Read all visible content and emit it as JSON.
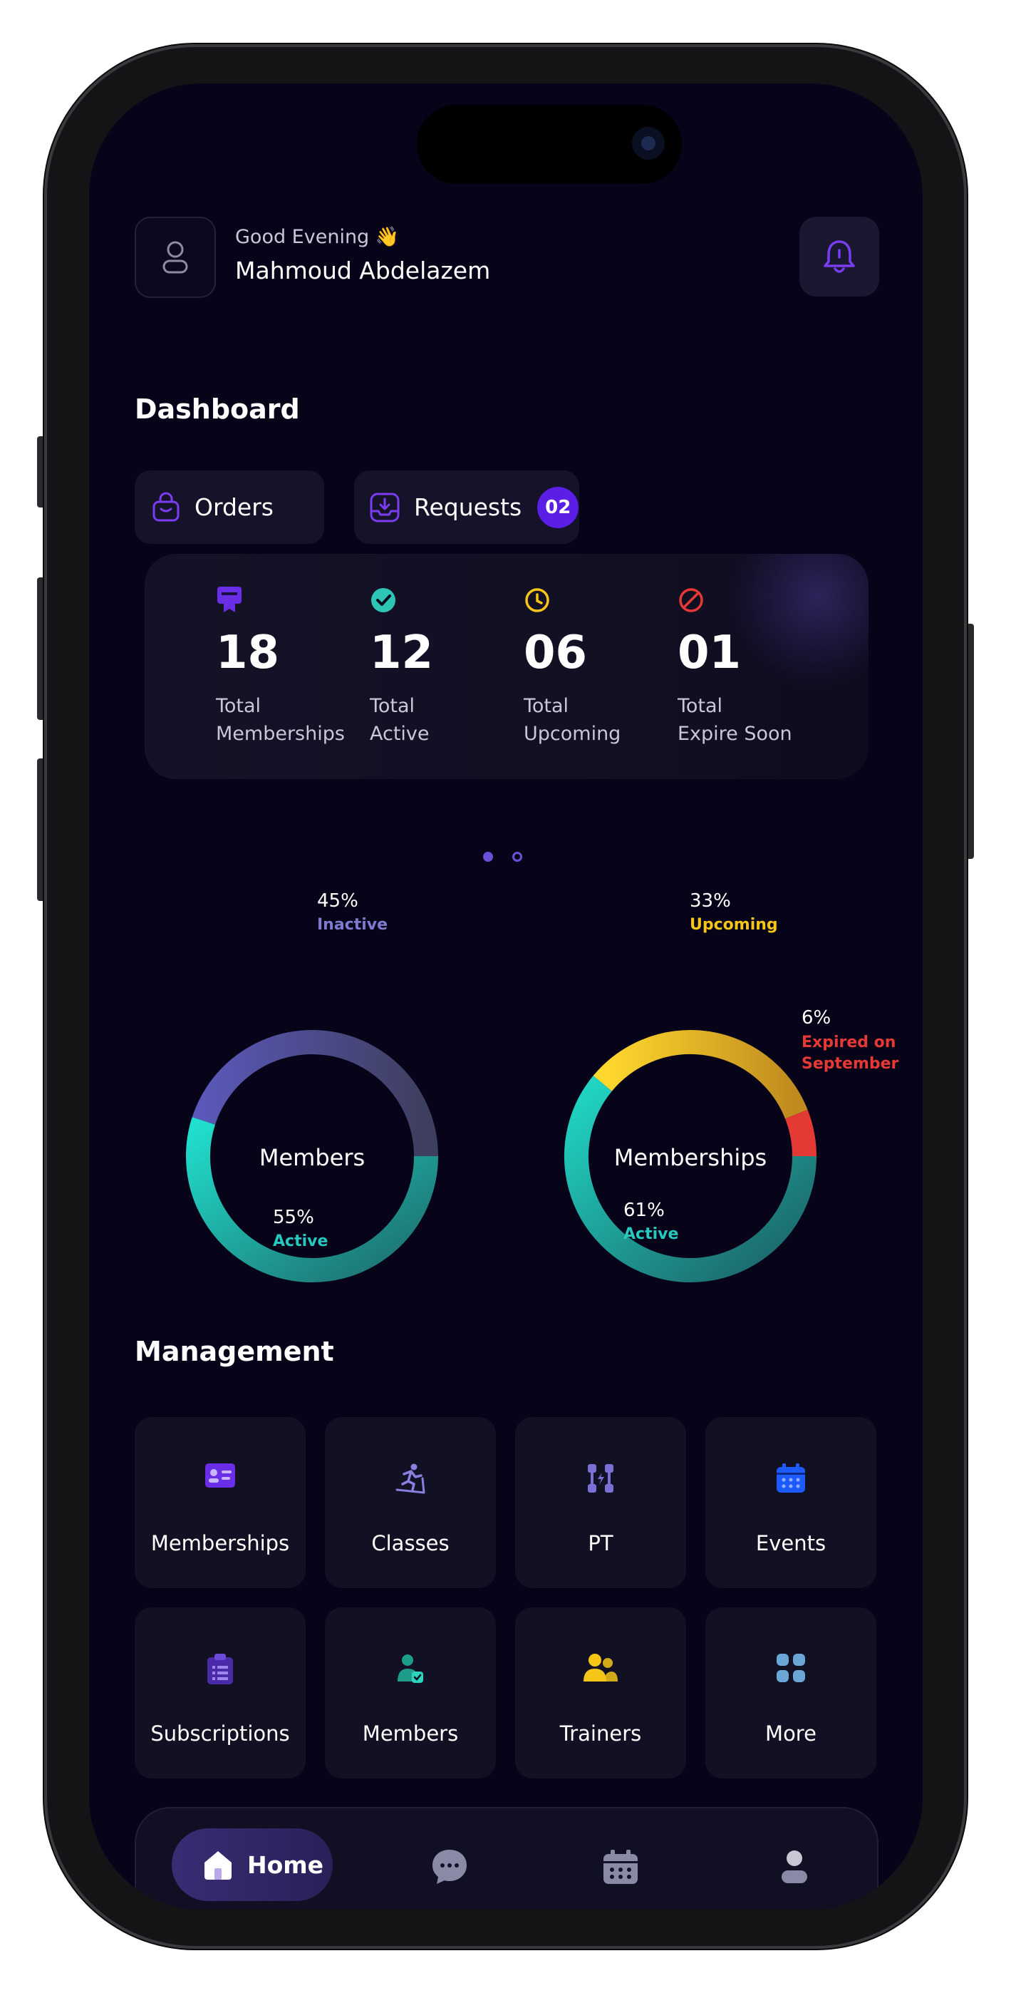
{
  "header": {
    "greeting": "Good Evening 👋",
    "user_name": "Mahmoud Abdelazem"
  },
  "dashboard": {
    "title": "Dashboard",
    "orders_label": "Orders",
    "requests_label": "Requests",
    "requests_badge": "02"
  },
  "stats": [
    {
      "value": "18",
      "line1": "Total",
      "line2": "Memberships",
      "icon": "card-icon",
      "color": "#6a2ee8"
    },
    {
      "value": "12",
      "line1": "Total",
      "line2": "Active",
      "icon": "check-circle-icon",
      "color": "#2ec4b6"
    },
    {
      "value": "06",
      "line1": "Total",
      "line2": "Upcoming",
      "icon": "clock-icon",
      "color": "#f5c518"
    },
    {
      "value": "01",
      "line1": "Total",
      "line2": "Expire Soon",
      "icon": "ban-icon",
      "color": "#e53935"
    }
  ],
  "carousel": {
    "pages": 2,
    "active": 0
  },
  "members_chart": {
    "center_label": "Members",
    "slices": [
      {
        "label": "Inactive",
        "percent": 45,
        "percent_text": "45%",
        "color": "#4f4f9c"
      },
      {
        "label": "Active",
        "percent": 55,
        "percent_text": "55%",
        "color": "#1fd1c1"
      }
    ]
  },
  "memberships_chart": {
    "center_label": "Memberships",
    "slices": [
      {
        "label": "Upcoming",
        "percent": 33,
        "percent_text": "33%",
        "color": "#f5c518"
      },
      {
        "label": "Expired on September",
        "label_line1": "Expired on",
        "label_line2": "September",
        "percent": 6,
        "percent_text": "6%",
        "color": "#e53935"
      },
      {
        "label": "Active",
        "percent": 61,
        "percent_text": "61%",
        "color": "#1fbfb0"
      }
    ]
  },
  "management": {
    "title": "Management",
    "tiles": [
      {
        "label": "Memberships",
        "icon": "membership-card-icon",
        "color": "#6a2ee8"
      },
      {
        "label": "Classes",
        "icon": "treadmill-runner-icon",
        "color": "#7b6fd6"
      },
      {
        "label": "PT",
        "icon": "dumbbell-icon",
        "color": "#7b6fd6"
      },
      {
        "label": "Events",
        "icon": "calendar-icon",
        "color": "#1e5bff"
      },
      {
        "label": "Subscriptions",
        "icon": "clipboard-icon",
        "color": "#4a2aa8"
      },
      {
        "label": "Members",
        "icon": "member-check-icon",
        "color": "#1f9c8a"
      },
      {
        "label": "Trainers",
        "icon": "trainers-icon",
        "color": "#f5c518"
      },
      {
        "label": "More",
        "icon": "grid-icon",
        "color": "#6aa7d6"
      }
    ]
  },
  "nav": {
    "home_label": "Home",
    "items": [
      "home-icon",
      "chat-icon",
      "calendar-icon",
      "profile-icon"
    ]
  },
  "bottom_progress": {
    "fraction": 0.185
  }
}
